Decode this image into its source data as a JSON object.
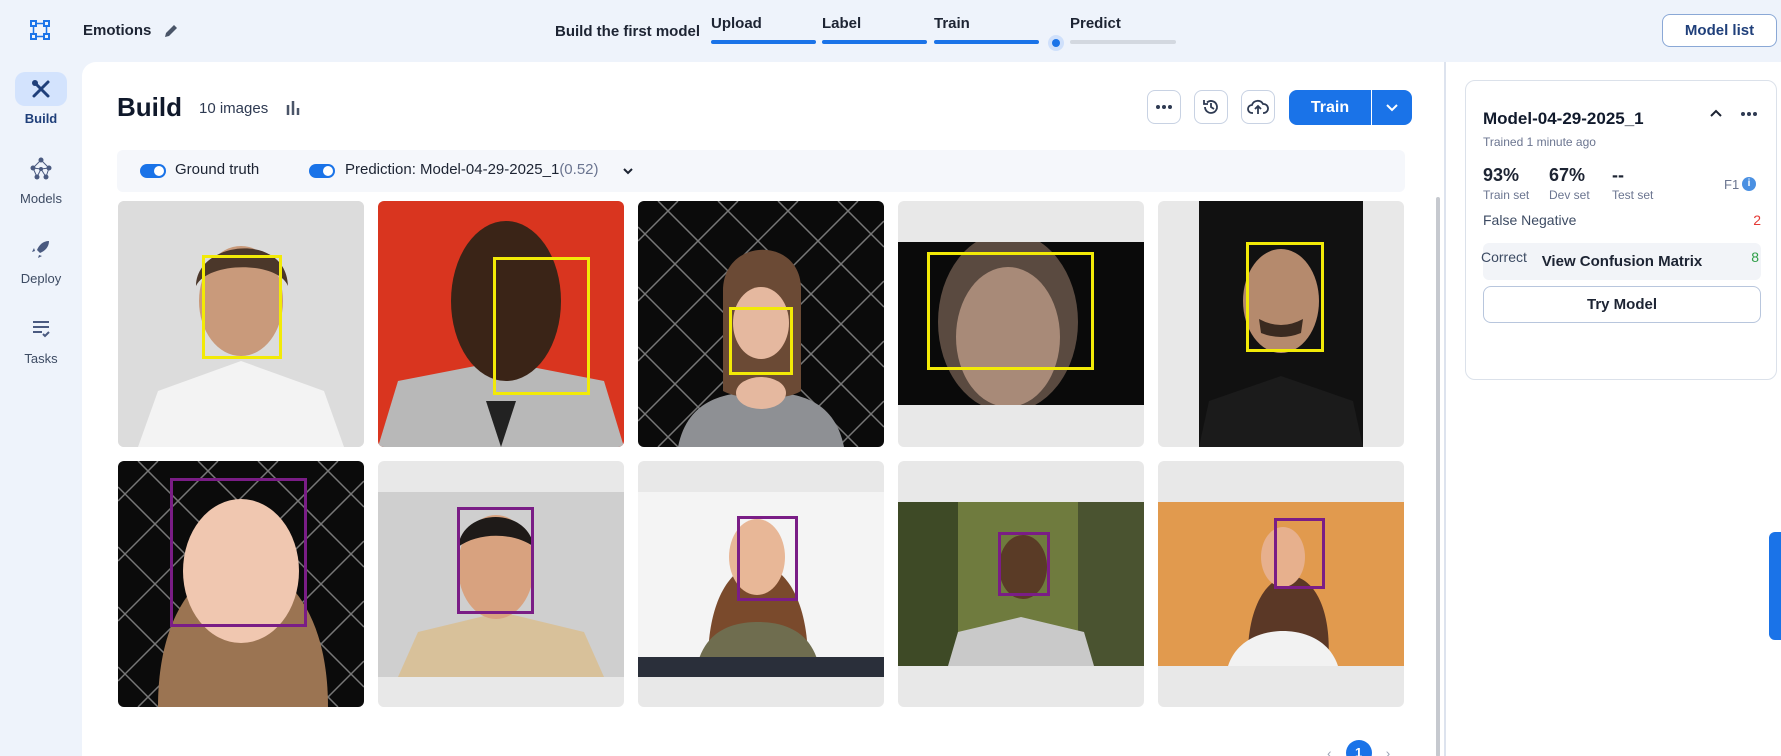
{
  "app": {
    "project_title": "Emotions"
  },
  "steps": {
    "label": "Build the first model",
    "items": [
      {
        "label": "Upload",
        "status": "done"
      },
      {
        "label": "Label",
        "status": "done"
      },
      {
        "label": "Train",
        "status": "done"
      },
      {
        "label": "Predict",
        "status": "current"
      }
    ]
  },
  "header": {
    "model_list_label": "Model list"
  },
  "nav": {
    "items": [
      {
        "label": "Build",
        "icon": "tools-icon",
        "active": true
      },
      {
        "label": "Models",
        "icon": "network-icon",
        "active": false
      },
      {
        "label": "Deploy",
        "icon": "rocket-icon",
        "active": false
      },
      {
        "label": "Tasks",
        "icon": "tasks-icon",
        "active": false
      }
    ]
  },
  "build": {
    "title": "Build",
    "image_count": "10 images",
    "train_label": "Train"
  },
  "filters": {
    "ground_truth_label": "Ground truth",
    "prediction_label": "Prediction: Model-04-29-2025_1",
    "prediction_score": "(0.52)"
  },
  "pagination": {
    "current_page": "1"
  },
  "model_card": {
    "name": "Model-04-29-2025_1",
    "trained_label": "Trained 1 minute ago",
    "metrics": [
      {
        "value": "93%",
        "label": "Train set"
      },
      {
        "value": "67%",
        "label": "Dev set"
      },
      {
        "value": "--",
        "label": "Test set"
      }
    ],
    "metric_type": "F1",
    "false_negative_label": "False Negative",
    "false_negative_value": "2",
    "correct_label": "Correct",
    "correct_value": "8",
    "confusion_label": "View Confusion Matrix",
    "try_label": "Try Model"
  },
  "colors": {
    "accent": "#1a73e8",
    "box_yellow": "#f2ea07",
    "box_purple": "#7a1d86",
    "false_negative": "#e53935",
    "correct": "#2e9e47"
  }
}
